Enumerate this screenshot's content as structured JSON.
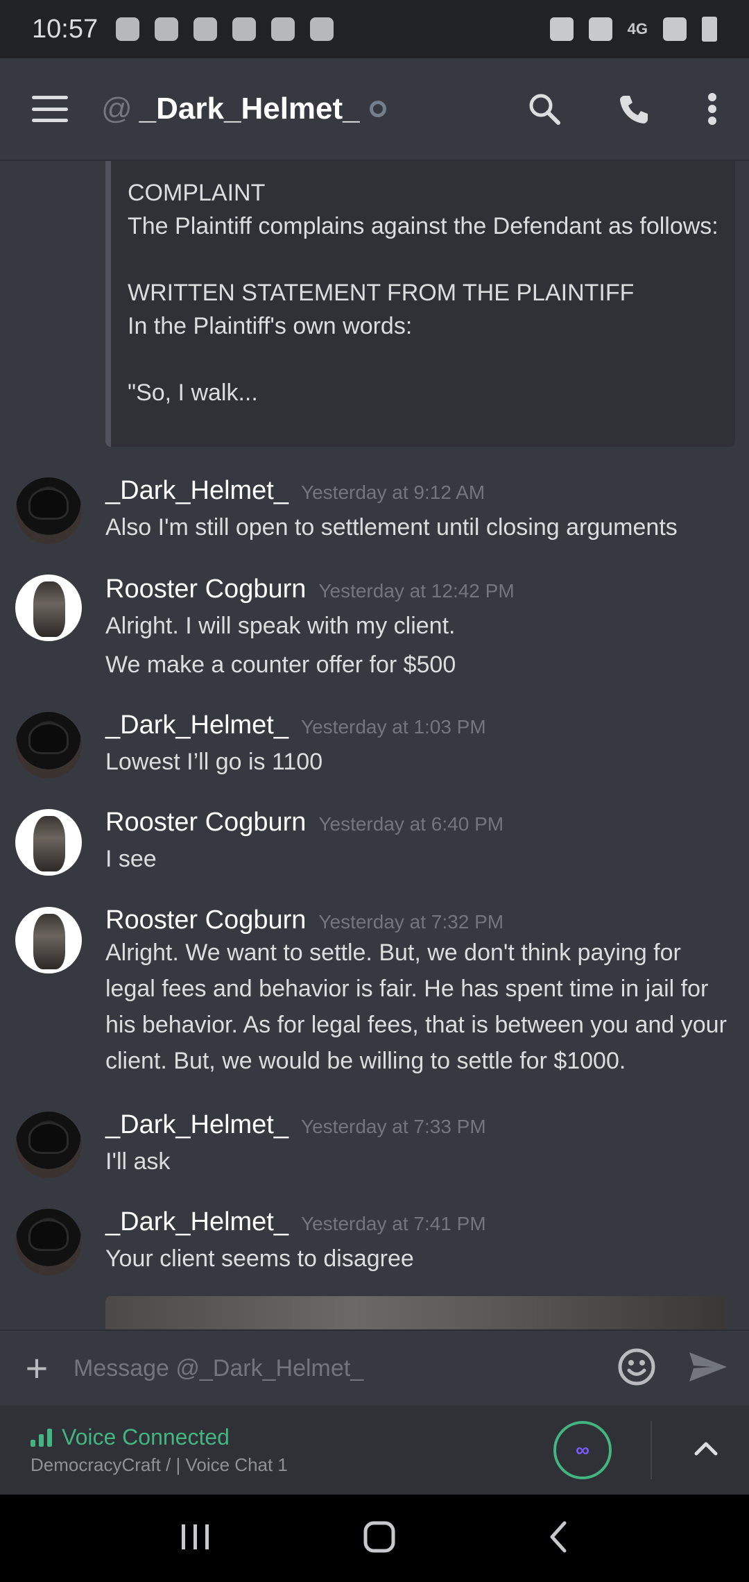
{
  "status_bar": {
    "time": "10:57",
    "network": "4G"
  },
  "header": {
    "at": "@",
    "channel_name": "_Dark_Helmet_"
  },
  "embed": {
    "text": "COMPLAINT\nThe Plaintiff complains against the Defendant as follows:\n\nWRITTEN STATEMENT FROM THE PLAINTIFF\nIn the Plaintiff's own words:\n\n\"So, I walk..."
  },
  "messages": [
    {
      "author": "_Dark_Helmet_",
      "time": "Yesterday at 9:12 AM",
      "lines": [
        "Also I'm still open to settlement until closing arguments"
      ]
    },
    {
      "author": "Rooster Cogburn",
      "time": "Yesterday at 12:42 PM",
      "lines": [
        "Alright. I will speak with my client.",
        "We make a counter offer for $500"
      ]
    },
    {
      "author": "_Dark_Helmet_",
      "time": "Yesterday at 1:03 PM",
      "lines": [
        "Lowest I’ll go is 1100"
      ]
    },
    {
      "author": "Rooster Cogburn",
      "time": "Yesterday at 6:40 PM",
      "lines": [
        "I see"
      ]
    },
    {
      "author": "Rooster Cogburn",
      "time": "Yesterday at 7:32 PM",
      "lines": [
        "Alright. We want to settle. But, we don't think paying for legal fees and behavior is fair. He has spent time in jail for his behavior. As for legal fees, that is between you and your client. But, we would be willing to settle for $1000."
      ]
    },
    {
      "author": "_Dark_Helmet_",
      "time": "Yesterday at 7:33 PM",
      "lines": [
        "I'll ask"
      ]
    },
    {
      "author": "_Dark_Helmet_",
      "time": "Yesterday at 7:41 PM",
      "lines": [
        "Your client seems to disagree"
      ]
    }
  ],
  "composer": {
    "placeholder": "Message @_Dark_Helmet_"
  },
  "voice": {
    "title": "Voice Connected",
    "subtitle": "DemocracyCraft / | Voice Chat 1"
  },
  "colors": {
    "background": "#36393f",
    "accent_green": "#43b581",
    "muted": "#72767d"
  }
}
